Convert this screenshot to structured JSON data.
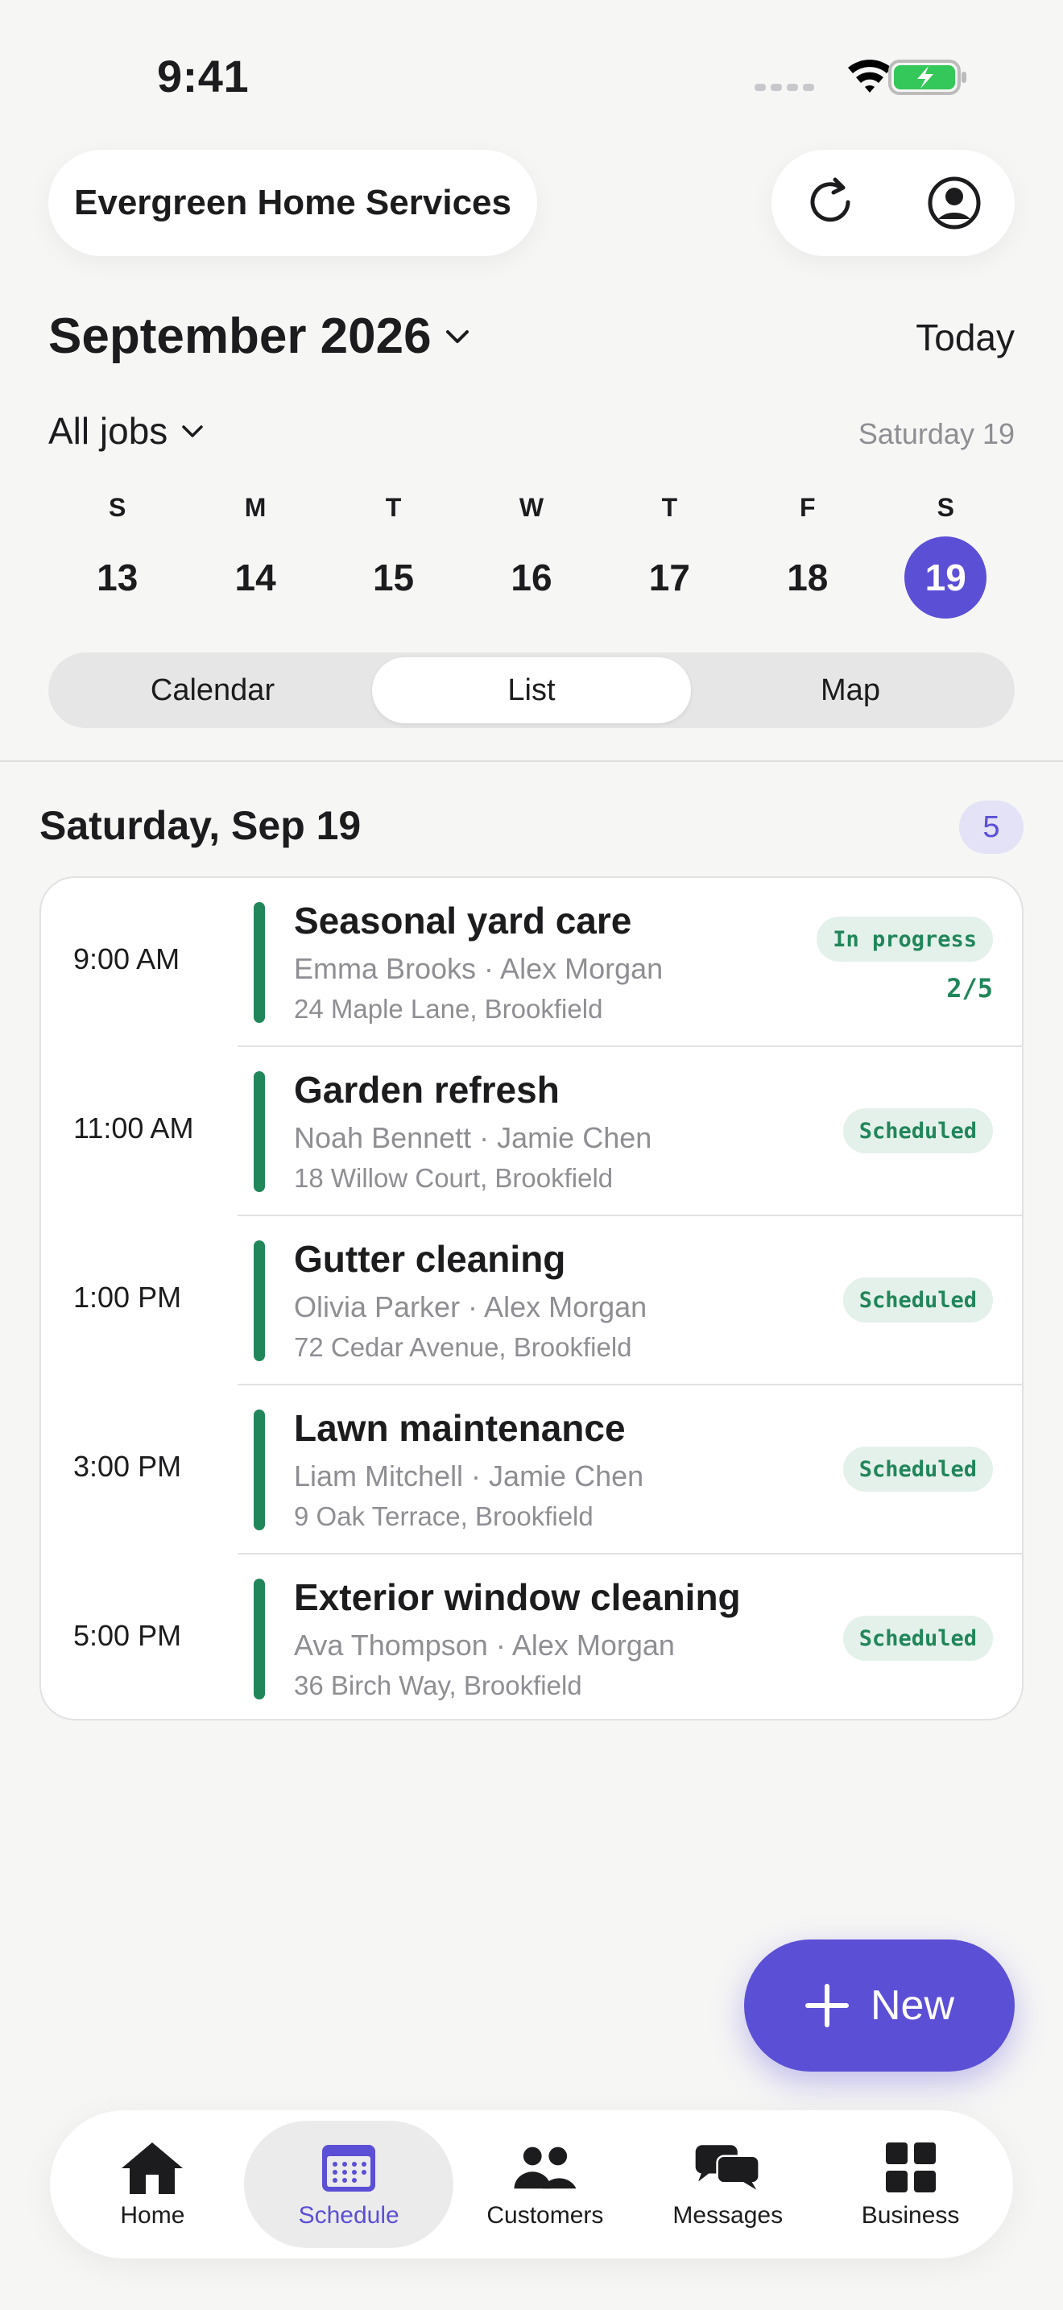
{
  "status_bar": {
    "time": "9:41"
  },
  "header": {
    "business_name": "Evergreen Home Services"
  },
  "calendar": {
    "month_label": "September 2026",
    "today_label": "Today",
    "filter_label": "All jobs",
    "selected_date_label": "Saturday 19",
    "week": [
      {
        "letter": "S",
        "num": "13"
      },
      {
        "letter": "M",
        "num": "14"
      },
      {
        "letter": "T",
        "num": "15"
      },
      {
        "letter": "W",
        "num": "16"
      },
      {
        "letter": "T",
        "num": "17"
      },
      {
        "letter": "F",
        "num": "18"
      },
      {
        "letter": "S",
        "num": "19"
      }
    ]
  },
  "view_tabs": [
    "Calendar",
    "List",
    "Map"
  ],
  "list": {
    "date_heading": "Saturday, Sep 19",
    "count": "5",
    "jobs": [
      {
        "time": "9:00 AM",
        "title": "Seasonal yard care",
        "people": "Emma Brooks · Alex Morgan",
        "address": "24 Maple Lane, Brookfield",
        "status": "In progress",
        "progress": "2/5"
      },
      {
        "time": "11:00 AM",
        "title": "Garden refresh",
        "people": "Noah Bennett · Jamie Chen",
        "address": "18 Willow Court, Brookfield",
        "status": "Scheduled"
      },
      {
        "time": "1:00 PM",
        "title": "Gutter cleaning",
        "people": "Olivia Parker · Alex Morgan",
        "address": "72 Cedar Avenue, Brookfield",
        "status": "Scheduled"
      },
      {
        "time": "3:00 PM",
        "title": "Lawn maintenance",
        "people": "Liam Mitchell · Jamie Chen",
        "address": "9 Oak Terrace, Brookfield",
        "status": "Scheduled"
      },
      {
        "time": "5:00 PM",
        "title": "Exterior window cleaning",
        "people": "Ava Thompson · Alex Morgan",
        "address": "36 Birch Way, Brookfield",
        "status": "Scheduled"
      }
    ]
  },
  "fab": {
    "label": "New"
  },
  "tabbar": {
    "items": [
      {
        "label": "Home",
        "icon": "house-icon"
      },
      {
        "label": "Schedule",
        "icon": "calendar-icon"
      },
      {
        "label": "Customers",
        "icon": "people-icon"
      },
      {
        "label": "Messages",
        "icon": "chat-bubbles-icon"
      },
      {
        "label": "Business",
        "icon": "grid-icon"
      }
    ]
  },
  "colors": {
    "accent": "#5b4fd6",
    "status_green": "#21865a",
    "status_bg": "#e4f1ea"
  }
}
